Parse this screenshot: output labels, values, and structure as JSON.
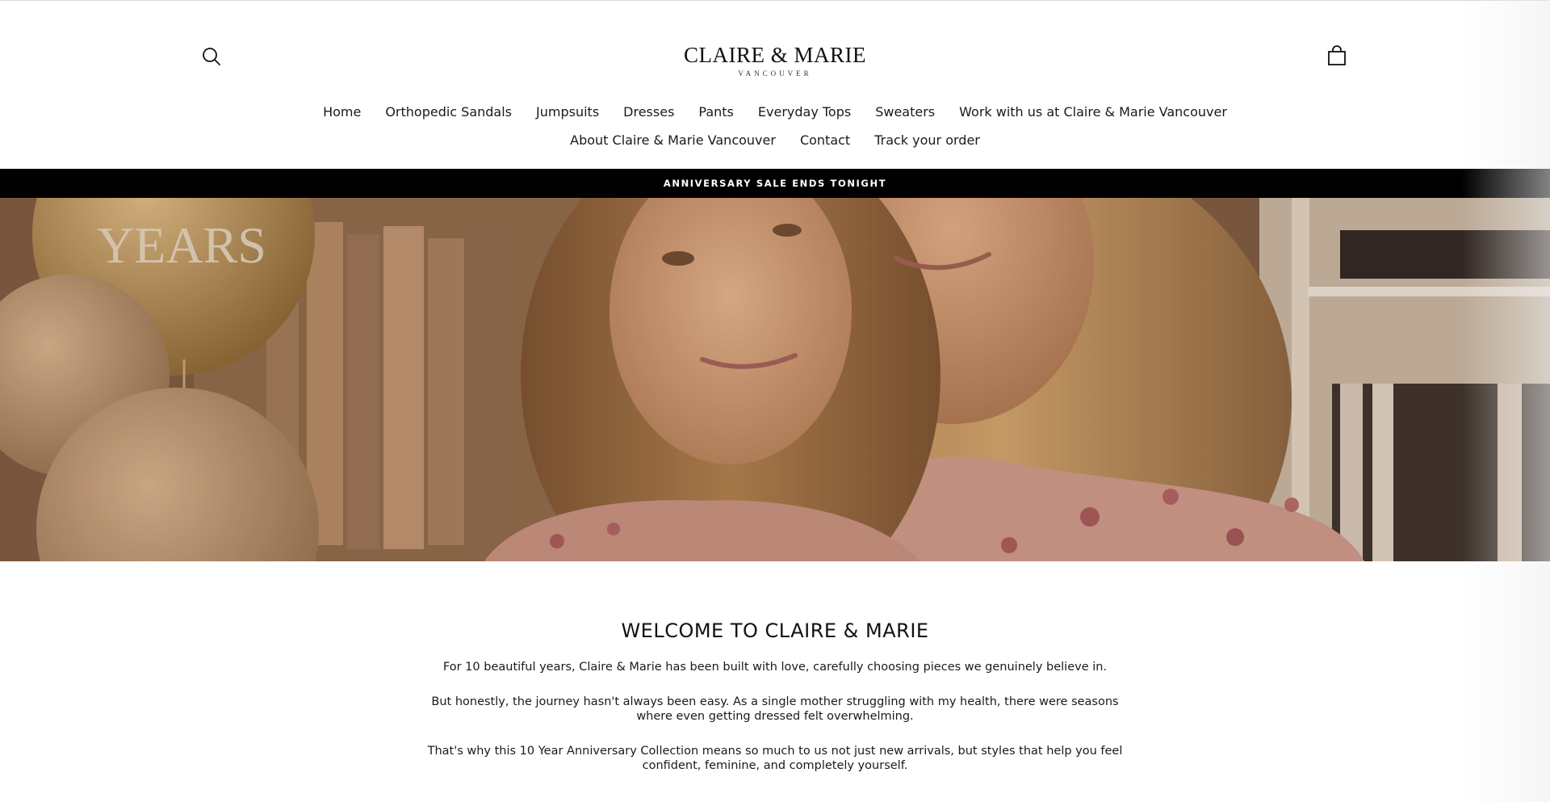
{
  "header": {
    "search_icon": "search-icon",
    "cart_icon": "shopping-bag-icon",
    "logo": {
      "name": "CLAIRE & MARIE",
      "location": "VANCOUVER"
    }
  },
  "nav": {
    "row1": [
      {
        "label": "Home"
      },
      {
        "label": "Orthopedic Sandals"
      },
      {
        "label": "Jumpsuits"
      },
      {
        "label": "Dresses"
      },
      {
        "label": "Pants"
      },
      {
        "label": "Everyday Tops"
      },
      {
        "label": "Sweaters"
      },
      {
        "label": "Work with us at Claire & Marie Vancouver"
      }
    ],
    "row2": [
      {
        "label": "About Claire & Marie Vancouver"
      },
      {
        "label": "Contact"
      },
      {
        "label": "Track your order"
      }
    ]
  },
  "announcement": {
    "text": "ANNIVERSARY SALE ENDS TONIGHT",
    "background": "#000000",
    "color": "#ffffff"
  },
  "hero": {
    "balloon_text": "YEARS"
  },
  "welcome": {
    "title": "WELCOME TO CLAIRE & MARIE",
    "paragraphs": [
      "For 10 beautiful years, Claire & Marie has been built with love, carefully choosing pieces we genuinely believe in.",
      "But honestly, the journey hasn't always been easy. As a single mother struggling with my health, there were seasons where even getting dressed felt overwhelming.",
      "That's why this 10 Year Anniversary Collection means so much to us not just new arrivals, but styles that help you feel confident, feminine, and completely yourself."
    ]
  }
}
